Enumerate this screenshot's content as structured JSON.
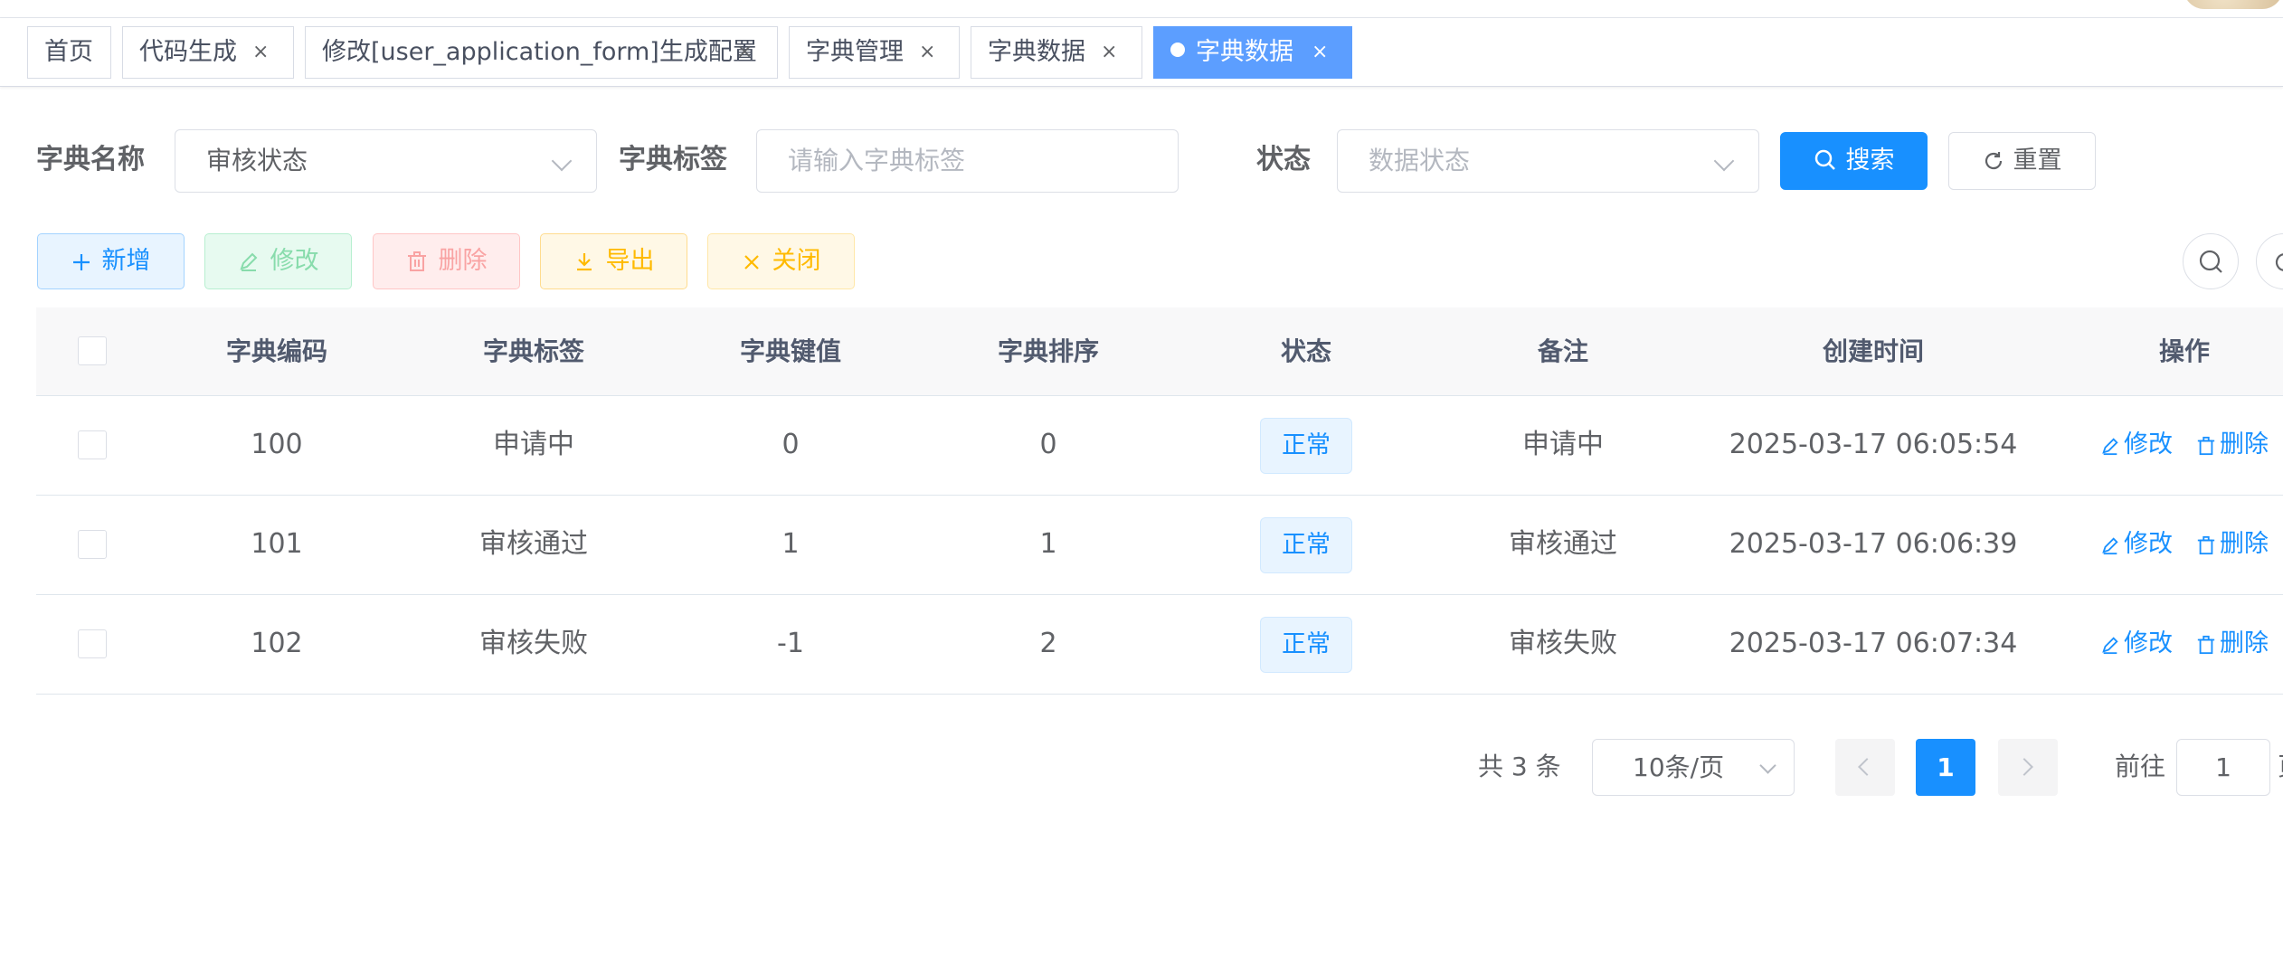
{
  "tabs": [
    {
      "label": "首页",
      "closable": false
    },
    {
      "label": "代码生成",
      "closable": true
    },
    {
      "label": "修改[user_application_form]生成配置",
      "closable": true
    },
    {
      "label": "字典管理",
      "closable": true
    },
    {
      "label": "字典数据",
      "closable": true
    },
    {
      "label": "字典数据",
      "closable": true,
      "active": true
    }
  ],
  "close_glyph": "×",
  "search": {
    "dict_name_label": "字典名称",
    "dict_name_value": "审核状态",
    "dict_label_label": "字典标签",
    "dict_label_placeholder": "请输入字典标签",
    "status_label": "状态",
    "status_placeholder": "数据状态",
    "search_button": "搜索",
    "reset_button": "重置"
  },
  "toolbar": {
    "add": "新增",
    "edit": "修改",
    "delete": "删除",
    "export": "导出",
    "close": "关闭"
  },
  "table": {
    "headers": [
      "字典编码",
      "字典标签",
      "字典键值",
      "字典排序",
      "状态",
      "备注",
      "创建时间",
      "操作"
    ],
    "rows": [
      {
        "code": "100",
        "label": "申请中",
        "value": "0",
        "sort": "0",
        "status": "正常",
        "remark": "申请中",
        "created": "2025-03-17 06:05:54",
        "edit": "修改",
        "delete": "删除"
      },
      {
        "code": "101",
        "label": "审核通过",
        "value": "1",
        "sort": "1",
        "status": "正常",
        "remark": "审核通过",
        "created": "2025-03-17 06:06:39",
        "edit": "修改",
        "delete": "删除"
      },
      {
        "code": "102",
        "label": "审核失败",
        "value": "-1",
        "sort": "2",
        "status": "正常",
        "remark": "审核失败",
        "created": "2025-03-17 06:07:34",
        "edit": "修改",
        "delete": "删除"
      }
    ]
  },
  "pagination": {
    "total": "共 3 条",
    "page_size": "10条/页",
    "current_page": "1",
    "goto_label": "前往",
    "goto_value": "1",
    "goto_suffix": "页"
  },
  "colors": {
    "primary": "#1890ff",
    "active_tab": "#5c9eff",
    "success": "#13ce66",
    "danger": "#ff4949",
    "warning": "#ffba00"
  }
}
